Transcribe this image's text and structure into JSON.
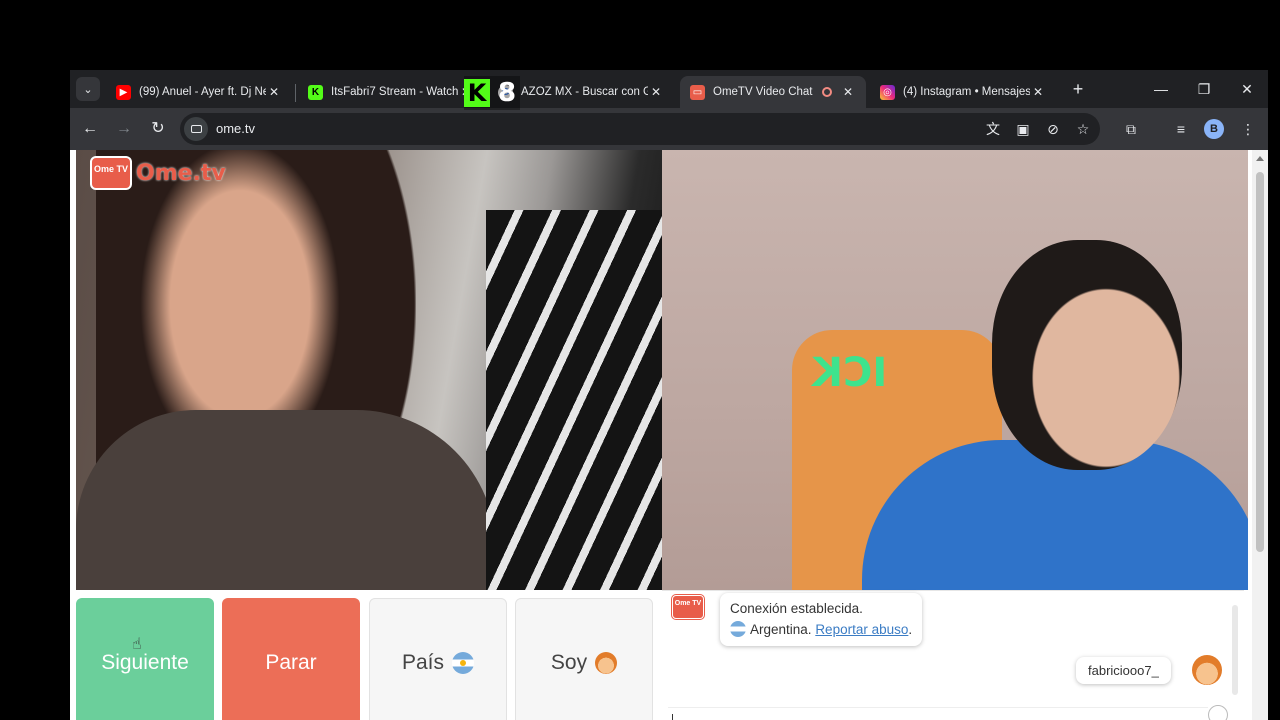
{
  "browser": {
    "tabs": [
      {
        "title": "(99) Anuel - Ayer ft. Dj Ne",
        "favicon": "youtube-icon",
        "active": false
      },
      {
        "title": "ItsFabri7 Stream - Watch",
        "favicon": "kick-icon",
        "active": false
      },
      {
        "title": "AZOZ MX - Buscar con G",
        "favicon": "google-icon",
        "active": false
      },
      {
        "title": "OmeTV Video Chat -",
        "favicon": "ometv-icon",
        "active": true,
        "recording": true
      },
      {
        "title": "(4) Instagram • Mensajes",
        "favicon": "instagram-icon",
        "active": false
      }
    ],
    "url": "ome.tv",
    "profile_initial": "B"
  },
  "overlay": {
    "kick_viewers": "8"
  },
  "ometv": {
    "watermark_box": "Ome TV",
    "watermark_text": "Ome.tv",
    "buttons": {
      "next": "Siguiente",
      "stop": "Parar",
      "country": "País",
      "gender": "Soy"
    },
    "chat": {
      "logo": "Ome TV",
      "connected": "Conexión establecida.",
      "country": "Argentina.",
      "report": "Reportar abuso",
      "report_suffix": ".",
      "my_name": "fabriciooo7_"
    },
    "remote_chair_label": "ICK"
  },
  "colors": {
    "next_button": "#6bcf9b",
    "stop_button": "#ec6e57",
    "brand": "#e85d4a",
    "kick_green": "#53fc18"
  }
}
